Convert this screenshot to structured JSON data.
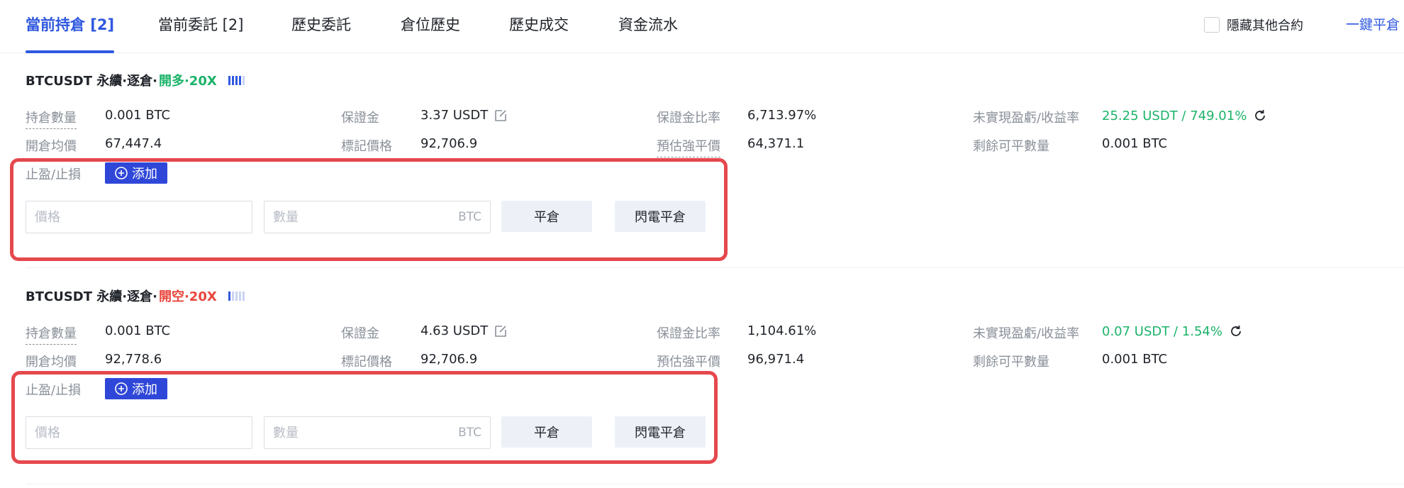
{
  "tabs": [
    {
      "label": "當前持倉 [2]"
    },
    {
      "label": "當前委託 [2]"
    },
    {
      "label": "歷史委託"
    },
    {
      "label": "倉位歷史"
    },
    {
      "label": "歷史成交"
    },
    {
      "label": "資金流水"
    }
  ],
  "hide_other": "隱藏其他合約",
  "close_all": "一鍵平倉",
  "colors": {
    "accent": "#2f58e0",
    "long": "#1bb36a",
    "short": "#e8453c",
    "highlight": "#e5484d"
  },
  "positions": [
    {
      "title": "BTCUSDT 永續·逐倉·",
      "side": "開多·20X",
      "side_type": "long",
      "hold_qty_label": "持倉數量",
      "hold_qty": "0.001 BTC",
      "entry_label": "開倉均價",
      "entry": "67,447.4",
      "margin_label": "保證金",
      "margin": "3.37 USDT",
      "mark_label": "標記價格",
      "mark": "92,706.9",
      "margin_ratio_label": "保證金比率",
      "margin_ratio": "6,713.97%",
      "liq_label": "預估強平價",
      "liq": "64,371.1",
      "pnl_label": "未實現盈虧/收益率",
      "pnl": "25.25 USDT / 749.01%",
      "remain_label": "剩餘可平數量",
      "remain": "0.001 BTC",
      "tpsl_label": "止盈/止損",
      "add_label": "添加",
      "price_placeholder": "價格",
      "qty_placeholder": "數量",
      "qty_unit": "BTC",
      "close_label": "平倉",
      "flash_close_label": "閃電平倉"
    },
    {
      "title": "BTCUSDT 永續·逐倉·",
      "side": "開空·20X",
      "side_type": "short",
      "hold_qty_label": "持倉數量",
      "hold_qty": "0.001 BTC",
      "entry_label": "開倉均價",
      "entry": "92,778.6",
      "margin_label": "保證金",
      "margin": "4.63 USDT",
      "mark_label": "標記價格",
      "mark": "92,706.9",
      "margin_ratio_label": "保證金比率",
      "margin_ratio": "1,104.61%",
      "liq_label": "預估強平價",
      "liq": "96,971.4",
      "pnl_label": "未實現盈虧/收益率",
      "pnl": "0.07 USDT / 1.54%",
      "remain_label": "剩餘可平數量",
      "remain": "0.001 BTC",
      "tpsl_label": "止盈/止損",
      "add_label": "添加",
      "price_placeholder": "價格",
      "qty_placeholder": "數量",
      "qty_unit": "BTC",
      "close_label": "平倉",
      "flash_close_label": "閃電平倉"
    }
  ]
}
